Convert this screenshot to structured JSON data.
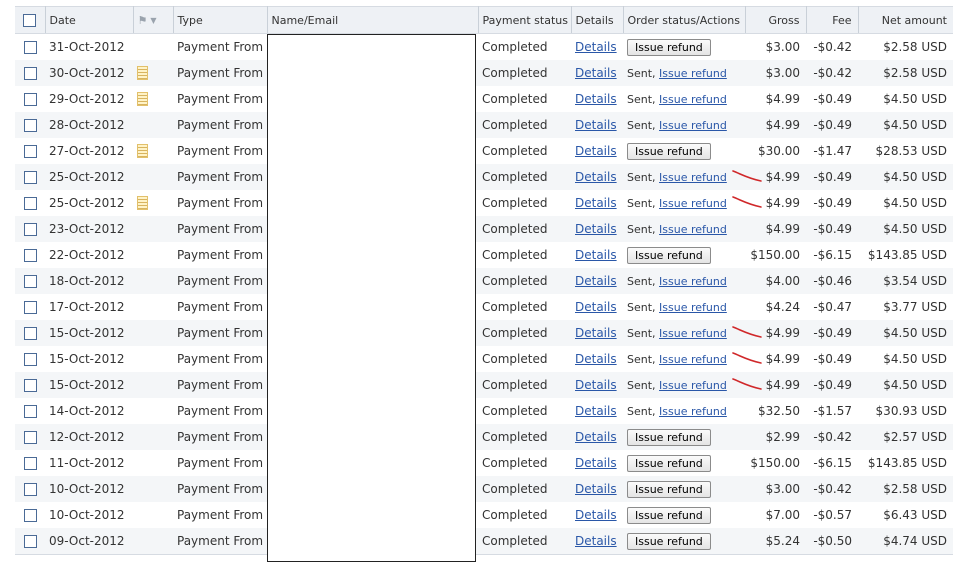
{
  "columns": [
    {
      "key": "select",
      "label": ""
    },
    {
      "key": "date",
      "label": "Date"
    },
    {
      "key": "flag",
      "label": "",
      "icon": "flag-icon"
    },
    {
      "key": "type",
      "label": "Type"
    },
    {
      "key": "name",
      "label": "Name/Email"
    },
    {
      "key": "status",
      "label": "Payment status"
    },
    {
      "key": "details",
      "label": "Details"
    },
    {
      "key": "order",
      "label": "Order status/Actions"
    },
    {
      "key": "gross",
      "label": "Gross"
    },
    {
      "key": "fee",
      "label": "Fee"
    },
    {
      "key": "net",
      "label": "Net amount"
    }
  ],
  "link_color": "#2a57a8",
  "annotation_color": "#d0282a",
  "rows": [
    {
      "date": "31-Oct-2012",
      "note": false,
      "type": "Payment From",
      "status": "Completed",
      "details": "Details",
      "action": "button",
      "action_label": "Issue refund",
      "sent": "",
      "gross": "$3.00",
      "fee": "-$0.42",
      "net": "$2.58 USD",
      "mark": false
    },
    {
      "date": "30-Oct-2012",
      "note": true,
      "type": "Payment From",
      "status": "Completed",
      "details": "Details",
      "action": "link",
      "action_label": "Issue refund",
      "sent": "Sent, ",
      "gross": "$3.00",
      "fee": "-$0.42",
      "net": "$2.58 USD",
      "mark": false
    },
    {
      "date": "29-Oct-2012",
      "note": true,
      "type": "Payment From",
      "status": "Completed",
      "details": "Details",
      "action": "link",
      "action_label": "Issue refund",
      "sent": "Sent, ",
      "gross": "$4.99",
      "fee": "-$0.49",
      "net": "$4.50 USD",
      "mark": false
    },
    {
      "date": "28-Oct-2012",
      "note": false,
      "type": "Payment From",
      "status": "Completed",
      "details": "Details",
      "action": "link",
      "action_label": "Issue refund",
      "sent": "Sent, ",
      "gross": "$4.99",
      "fee": "-$0.49",
      "net": "$4.50 USD",
      "mark": false
    },
    {
      "date": "27-Oct-2012",
      "note": true,
      "type": "Payment From",
      "status": "Completed",
      "details": "Details",
      "action": "button",
      "action_label": "Issue refund",
      "sent": "",
      "gross": "$30.00",
      "fee": "-$1.47",
      "net": "$28.53 USD",
      "mark": false
    },
    {
      "date": "25-Oct-2012",
      "note": false,
      "type": "Payment From",
      "status": "Completed",
      "details": "Details",
      "action": "link",
      "action_label": "Issue refund",
      "sent": "Sent, ",
      "gross": "$4.99",
      "fee": "-$0.49",
      "net": "$4.50 USD",
      "mark": true
    },
    {
      "date": "25-Oct-2012",
      "note": true,
      "type": "Payment From",
      "status": "Completed",
      "details": "Details",
      "action": "link",
      "action_label": "Issue refund",
      "sent": "Sent, ",
      "gross": "$4.99",
      "fee": "-$0.49",
      "net": "$4.50 USD",
      "mark": true
    },
    {
      "date": "23-Oct-2012",
      "note": false,
      "type": "Payment From",
      "status": "Completed",
      "details": "Details",
      "action": "link",
      "action_label": "Issue refund",
      "sent": "Sent, ",
      "gross": "$4.99",
      "fee": "-$0.49",
      "net": "$4.50 USD",
      "mark": false
    },
    {
      "date": "22-Oct-2012",
      "note": false,
      "type": "Payment From",
      "status": "Completed",
      "details": "Details",
      "action": "button",
      "action_label": "Issue refund",
      "sent": "",
      "gross": "$150.00",
      "fee": "-$6.15",
      "net": "$143.85 USD",
      "mark": false
    },
    {
      "date": "18-Oct-2012",
      "note": false,
      "type": "Payment From",
      "status": "Completed",
      "details": "Details",
      "action": "link",
      "action_label": "Issue refund",
      "sent": "Sent, ",
      "gross": "$4.00",
      "fee": "-$0.46",
      "net": "$3.54 USD",
      "mark": false
    },
    {
      "date": "17-Oct-2012",
      "note": false,
      "type": "Payment From",
      "status": "Completed",
      "details": "Details",
      "action": "link",
      "action_label": "Issue refund",
      "sent": "Sent, ",
      "gross": "$4.24",
      "fee": "-$0.47",
      "net": "$3.77 USD",
      "mark": false
    },
    {
      "date": "15-Oct-2012",
      "note": false,
      "type": "Payment From",
      "status": "Completed",
      "details": "Details",
      "action": "link",
      "action_label": "Issue refund",
      "sent": "Sent, ",
      "gross": "$4.99",
      "fee": "-$0.49",
      "net": "$4.50 USD",
      "mark": true
    },
    {
      "date": "15-Oct-2012",
      "note": false,
      "type": "Payment From",
      "status": "Completed",
      "details": "Details",
      "action": "link",
      "action_label": "Issue refund",
      "sent": "Sent, ",
      "gross": "$4.99",
      "fee": "-$0.49",
      "net": "$4.50 USD",
      "mark": true
    },
    {
      "date": "15-Oct-2012",
      "note": false,
      "type": "Payment From",
      "status": "Completed",
      "details": "Details",
      "action": "link",
      "action_label": "Issue refund",
      "sent": "Sent, ",
      "gross": "$4.99",
      "fee": "-$0.49",
      "net": "$4.50 USD",
      "mark": true
    },
    {
      "date": "14-Oct-2012",
      "note": false,
      "type": "Payment From",
      "status": "Completed",
      "details": "Details",
      "action": "link",
      "action_label": "Issue refund",
      "sent": "Sent, ",
      "gross": "$32.50",
      "fee": "-$1.57",
      "net": "$30.93 USD",
      "mark": false
    },
    {
      "date": "12-Oct-2012",
      "note": false,
      "type": "Payment From",
      "status": "Completed",
      "details": "Details",
      "action": "button",
      "action_label": "Issue refund",
      "sent": "",
      "gross": "$2.99",
      "fee": "-$0.42",
      "net": "$2.57 USD",
      "mark": false
    },
    {
      "date": "11-Oct-2012",
      "note": false,
      "type": "Payment From",
      "status": "Completed",
      "details": "Details",
      "action": "button",
      "action_label": "Issue refund",
      "sent": "",
      "gross": "$150.00",
      "fee": "-$6.15",
      "net": "$143.85 USD",
      "mark": false
    },
    {
      "date": "10-Oct-2012",
      "note": false,
      "type": "Payment From",
      "status": "Completed",
      "details": "Details",
      "action": "button",
      "action_label": "Issue refund",
      "sent": "",
      "gross": "$3.00",
      "fee": "-$0.42",
      "net": "$2.58 USD",
      "mark": false
    },
    {
      "date": "10-Oct-2012",
      "note": false,
      "type": "Payment From",
      "status": "Completed",
      "details": "Details",
      "action": "button",
      "action_label": "Issue refund",
      "sent": "",
      "gross": "$7.00",
      "fee": "-$0.57",
      "net": "$6.43 USD",
      "mark": false
    },
    {
      "date": "09-Oct-2012",
      "note": false,
      "type": "Payment From",
      "status": "Completed",
      "details": "Details",
      "action": "button",
      "action_label": "Issue refund",
      "sent": "",
      "gross": "$5.24",
      "fee": "-$0.50",
      "net": "$4.74 USD",
      "mark": false
    }
  ]
}
